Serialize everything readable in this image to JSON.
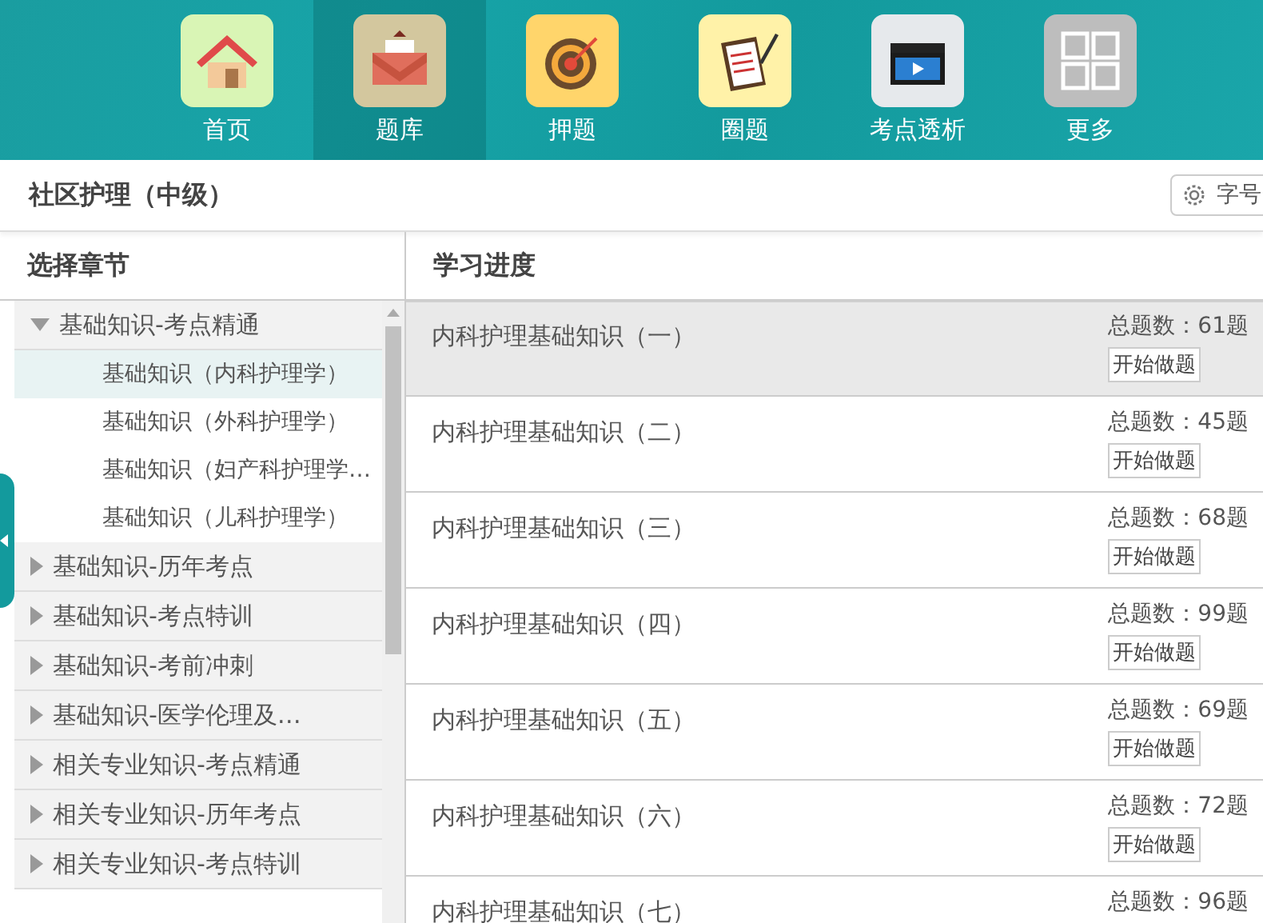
{
  "nav": [
    {
      "label": "首页",
      "kind": "home",
      "selected": false
    },
    {
      "label": "题库",
      "kind": "envelope",
      "selected": true
    },
    {
      "label": "押题",
      "kind": "target",
      "selected": false
    },
    {
      "label": "圈题",
      "kind": "clipboard",
      "selected": false
    },
    {
      "label": "考点透析",
      "kind": "video",
      "selected": false
    },
    {
      "label": "更多",
      "kind": "grid",
      "selected": false
    }
  ],
  "title": "社区护理（中级）",
  "font_button": {
    "label": "字号"
  },
  "sidebar": {
    "heading": "选择章节",
    "items": [
      {
        "label": "基础知识-考点精通",
        "expanded": true,
        "children": [
          {
            "label": "基础知识（内科护理学）",
            "selected": true
          },
          {
            "label": "基础知识（外科护理学）",
            "selected": false
          },
          {
            "label": "基础知识（妇产科护理学…",
            "selected": false
          },
          {
            "label": "基础知识（儿科护理学）",
            "selected": false
          }
        ]
      },
      {
        "label": "基础知识-历年考点",
        "expanded": false
      },
      {
        "label": "基础知识-考点特训",
        "expanded": false
      },
      {
        "label": "基础知识-考前冲刺",
        "expanded": false
      },
      {
        "label": "基础知识-医学伦理及…",
        "expanded": false
      },
      {
        "label": "相关专业知识-考点精通",
        "expanded": false
      },
      {
        "label": "相关专业知识-历年考点",
        "expanded": false
      },
      {
        "label": "相关专业知识-考点特训",
        "expanded": false
      }
    ]
  },
  "progress": {
    "heading": "学习进度",
    "rows": [
      {
        "title": "内科护理基础知识（一）",
        "count": "总题数：61题",
        "button": "开始做题",
        "selected": true
      },
      {
        "title": "内科护理基础知识（二）",
        "count": "总题数：45题",
        "button": "开始做题",
        "selected": false
      },
      {
        "title": "内科护理基础知识（三）",
        "count": "总题数：68题",
        "button": "开始做题",
        "selected": false
      },
      {
        "title": "内科护理基础知识（四）",
        "count": "总题数：99题",
        "button": "开始做题",
        "selected": false
      },
      {
        "title": "内科护理基础知识（五）",
        "count": "总题数：69题",
        "button": "开始做题",
        "selected": false
      },
      {
        "title": "内科护理基础知识（六）",
        "count": "总题数：72题",
        "button": "开始做题",
        "selected": false
      },
      {
        "title": "内科护理基础知识（七）",
        "count": "总题数：96题",
        "selected": false
      }
    ]
  }
}
